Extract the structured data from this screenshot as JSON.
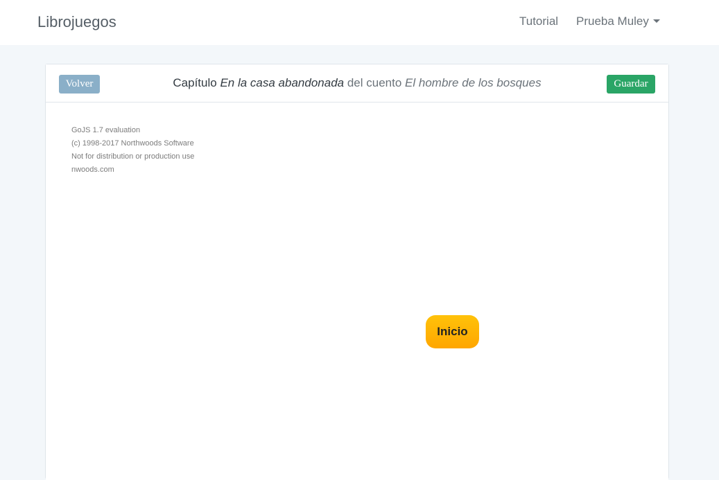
{
  "navbar": {
    "brand": "Librojuegos",
    "links": {
      "tutorial": "Tutorial",
      "user": "Prueba Muley"
    }
  },
  "panel": {
    "back_button": "Volver",
    "save_button": "Guardar",
    "title": {
      "prefix": "Capítulo",
      "chapter": "En la casa abandonada",
      "middle": "del cuento",
      "story": "El hombre de los bosques"
    }
  },
  "diagram": {
    "watermark": [
      "GoJS 1.7 evaluation",
      "(c) 1998-2017 Northwoods Software",
      "Not for distribution or production use",
      "nwoods.com"
    ],
    "nodes": [
      {
        "label": "Inicio",
        "color": "#ffb300"
      }
    ]
  },
  "colors": {
    "back": "#8aafc8",
    "save": "#2aa566",
    "node": "#ffb300"
  }
}
